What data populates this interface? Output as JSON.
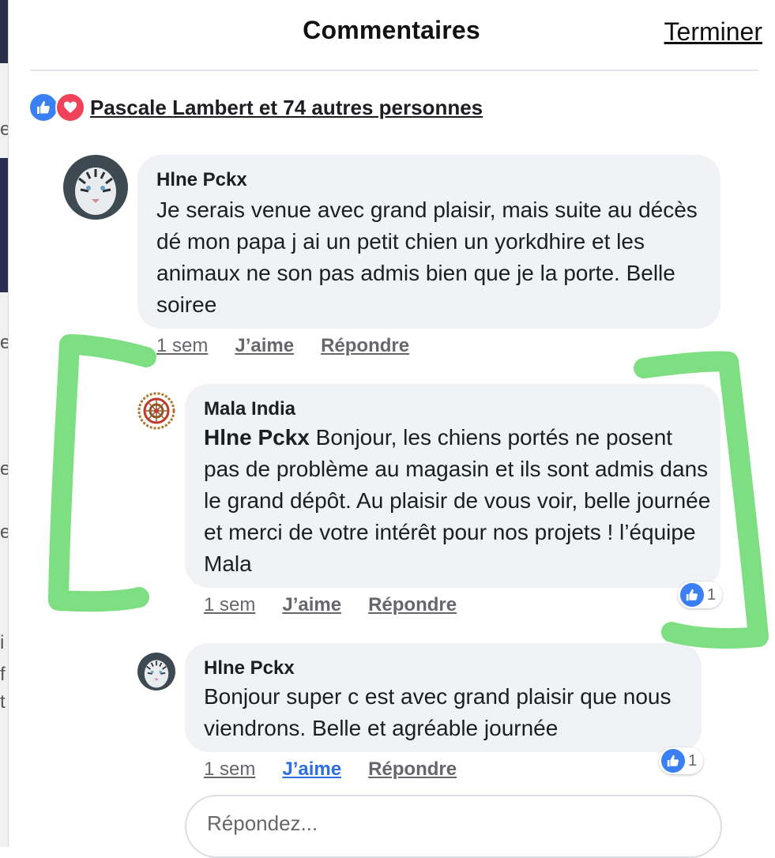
{
  "header": {
    "title": "Commentaires",
    "done_label": "Terminer"
  },
  "reactions": {
    "summary": "Pascale Lambert et 74 autres personnes"
  },
  "comments": [
    {
      "author": "Hlne Pckx",
      "text": "Je serais venue avec grand plaisir, mais suite au décès dé mon papa j ai un petit chien un yorkdhire et les animaux ne son pas admis bien que je la porte. Belle soiree",
      "time": "1 sem",
      "like": "J’aime",
      "reply": "Répondre"
    },
    {
      "author": "Mala India",
      "mention": "Hlne Pckx",
      "text": " Bonjour, les chiens portés ne posent pas de problème au magasin et ils sont admis dans le grand dépôt. Au plaisir de vous voir, belle journée et merci de votre intérêt pour nos projets ! l’équipe Mala",
      "time": "1 sem",
      "like": "J’aime",
      "reply": "Répondre",
      "like_count": "1"
    },
    {
      "author": "Hlne Pckx",
      "text": "Bonjour super c est avec grand plaisir que nous viendrons. Belle et agréable journée",
      "time": "1 sem",
      "like": "J’aime",
      "reply": "Répondre",
      "like_count": "1"
    }
  ],
  "reply_box": {
    "placeholder": "Répondez..."
  },
  "colors": {
    "like_blue": "#3b7ff5",
    "love_red": "#f0435a",
    "bubble": "#f0f2f5",
    "highlight": "#6fdc74"
  },
  "icons": [
    "like-icon",
    "love-icon",
    "tiger-avatar",
    "mandala-avatar"
  ]
}
